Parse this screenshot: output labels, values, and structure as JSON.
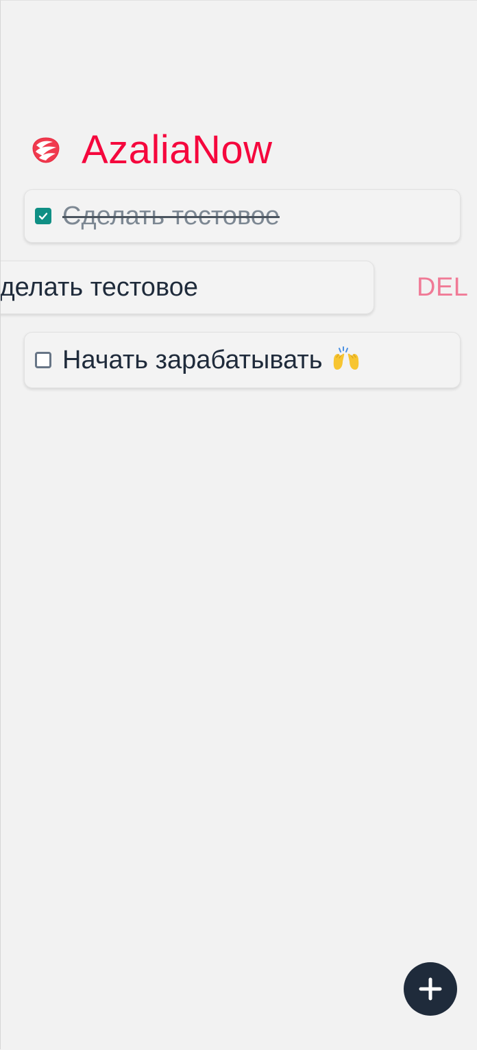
{
  "app": {
    "title": "AzaliaNow",
    "brand_color": "#f5073d",
    "logo_icon": "rose-icon"
  },
  "tasks": [
    {
      "text": "Сделать тестовое",
      "done": true,
      "emoji": ""
    },
    {
      "text": "Сделать тестовое",
      "done": false,
      "swiped": true,
      "emoji": ""
    },
    {
      "text": "Начать зарабатывать",
      "done": false,
      "emoji": "raising-hands-icon"
    }
  ],
  "actions": {
    "delete_label": "DEL",
    "add_icon": "plus-icon"
  },
  "colors": {
    "background": "#f2f2f2",
    "checked": "#0f8f84",
    "text": "#1f2b3b",
    "delete": "#f07a96",
    "fab": "#1f2b3b"
  }
}
